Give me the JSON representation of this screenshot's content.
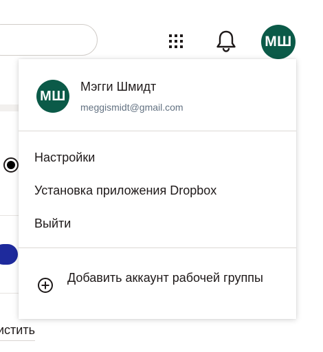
{
  "colors": {
    "avatar_bg": "#0b5a48",
    "text_primary": "#1e1919",
    "text_secondary": "#637282",
    "toggle_blue": "#1e2a9c"
  },
  "header": {
    "search_placeholder": "",
    "apps_icon": "grid-icon",
    "notifications_icon": "bell-icon",
    "avatar_initials": "МШ"
  },
  "background": {
    "clear_link_label": "истить"
  },
  "account_menu": {
    "user": {
      "initials": "МШ",
      "name": "Мэгги Шмидт",
      "email": "meggismidt@gmail.com"
    },
    "items": [
      {
        "label": "Настройки"
      },
      {
        "label": "Установка приложения Dropbox"
      },
      {
        "label": "Выйти"
      }
    ],
    "add_account": {
      "icon": "plus-circle-icon",
      "label": "Добавить аккаунт рабочей группы"
    }
  }
}
